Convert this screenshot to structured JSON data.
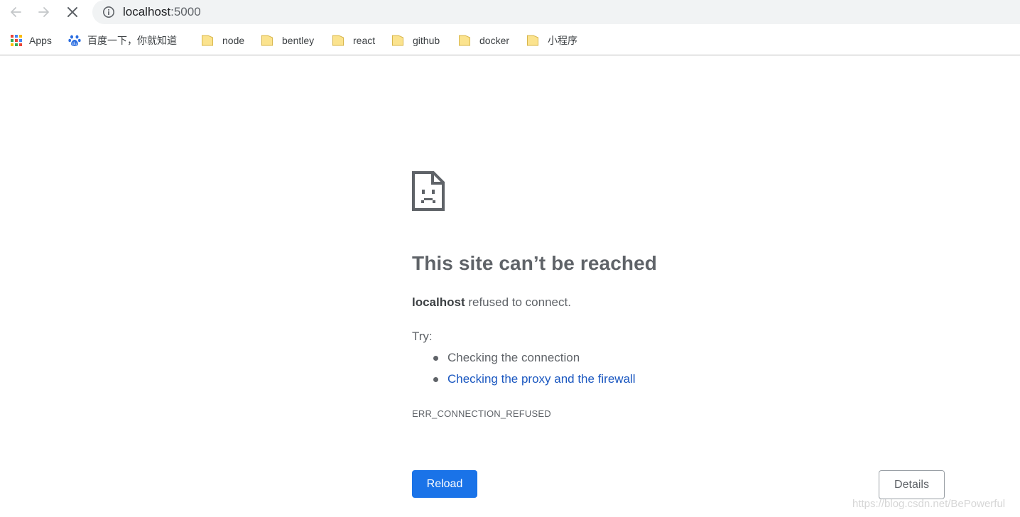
{
  "browser": {
    "url_host": "localhost",
    "url_port": ":5000"
  },
  "bookmarks": [
    {
      "label": "Apps",
      "icon": "apps-grid-icon"
    },
    {
      "label": "百度一下，你就知道",
      "icon": "baidu-paw-icon"
    },
    {
      "label": "node",
      "icon": "folder-icon"
    },
    {
      "label": "bentley",
      "icon": "folder-icon"
    },
    {
      "label": "react",
      "icon": "folder-icon"
    },
    {
      "label": "github",
      "icon": "folder-icon"
    },
    {
      "label": "docker",
      "icon": "folder-icon"
    },
    {
      "label": "小程序",
      "icon": "folder-icon"
    }
  ],
  "error": {
    "heading": "This site can’t be reached",
    "host": "localhost",
    "message": " refused to connect.",
    "try_label": "Try:",
    "suggestions": [
      {
        "text": "Checking the connection",
        "link": false
      },
      {
        "text": "Checking the proxy and the firewall",
        "link": true
      }
    ],
    "code": "ERR_CONNECTION_REFUSED"
  },
  "buttons": {
    "reload": "Reload",
    "details": "Details"
  },
  "watermark": "https://blog.csdn.net/BePowerful",
  "colors": {
    "primary_button": "#1a73e8",
    "link": "#1a57c0",
    "text": "#5f6368",
    "folder": "#fbe38e"
  }
}
